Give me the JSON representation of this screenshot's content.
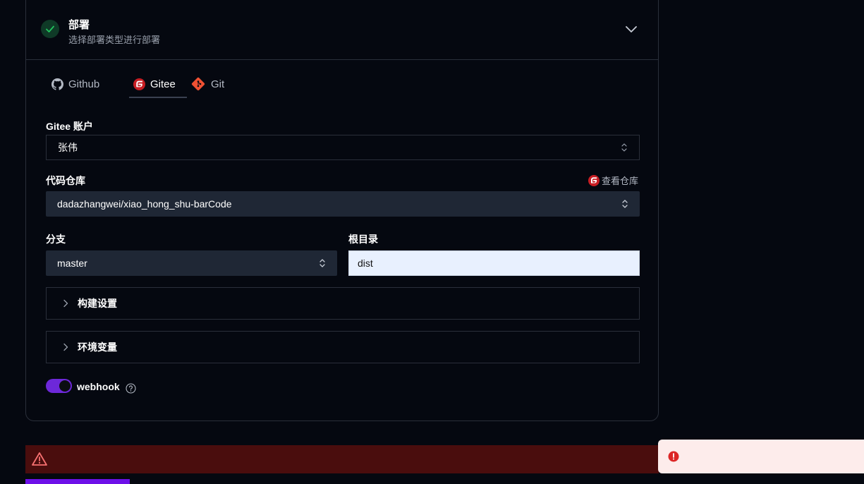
{
  "deploy_section": {
    "title": "部署",
    "subtitle": "选择部署类型进行部署",
    "status_icon": "check-icon",
    "status_color": "#22c55e"
  },
  "tabs": [
    {
      "label": "Github",
      "icon": "github-icon",
      "active": false
    },
    {
      "label": "Gitee",
      "icon": "gitee-icon",
      "active": true
    },
    {
      "label": "Git",
      "icon": "git-icon",
      "active": false
    }
  ],
  "account": {
    "label": "Gitee 账户",
    "value": "张伟"
  },
  "repository": {
    "label": "代码仓库",
    "view_link": "查看仓库",
    "value": "dadazhangwei/xiao_hong_shu-barCode"
  },
  "branch": {
    "label": "分支",
    "value": "master"
  },
  "root_dir": {
    "label": "根目录",
    "value": "dist"
  },
  "build_settings": {
    "label": "构建设置"
  },
  "env_vars": {
    "label": "环境变量"
  },
  "webhook": {
    "label": "webhook",
    "enabled": true
  },
  "colors": {
    "accent": "#6d28d9",
    "error_bar": "#4a0d0d",
    "gitee_red": "#c71d23",
    "git_orange": "#f05133"
  }
}
